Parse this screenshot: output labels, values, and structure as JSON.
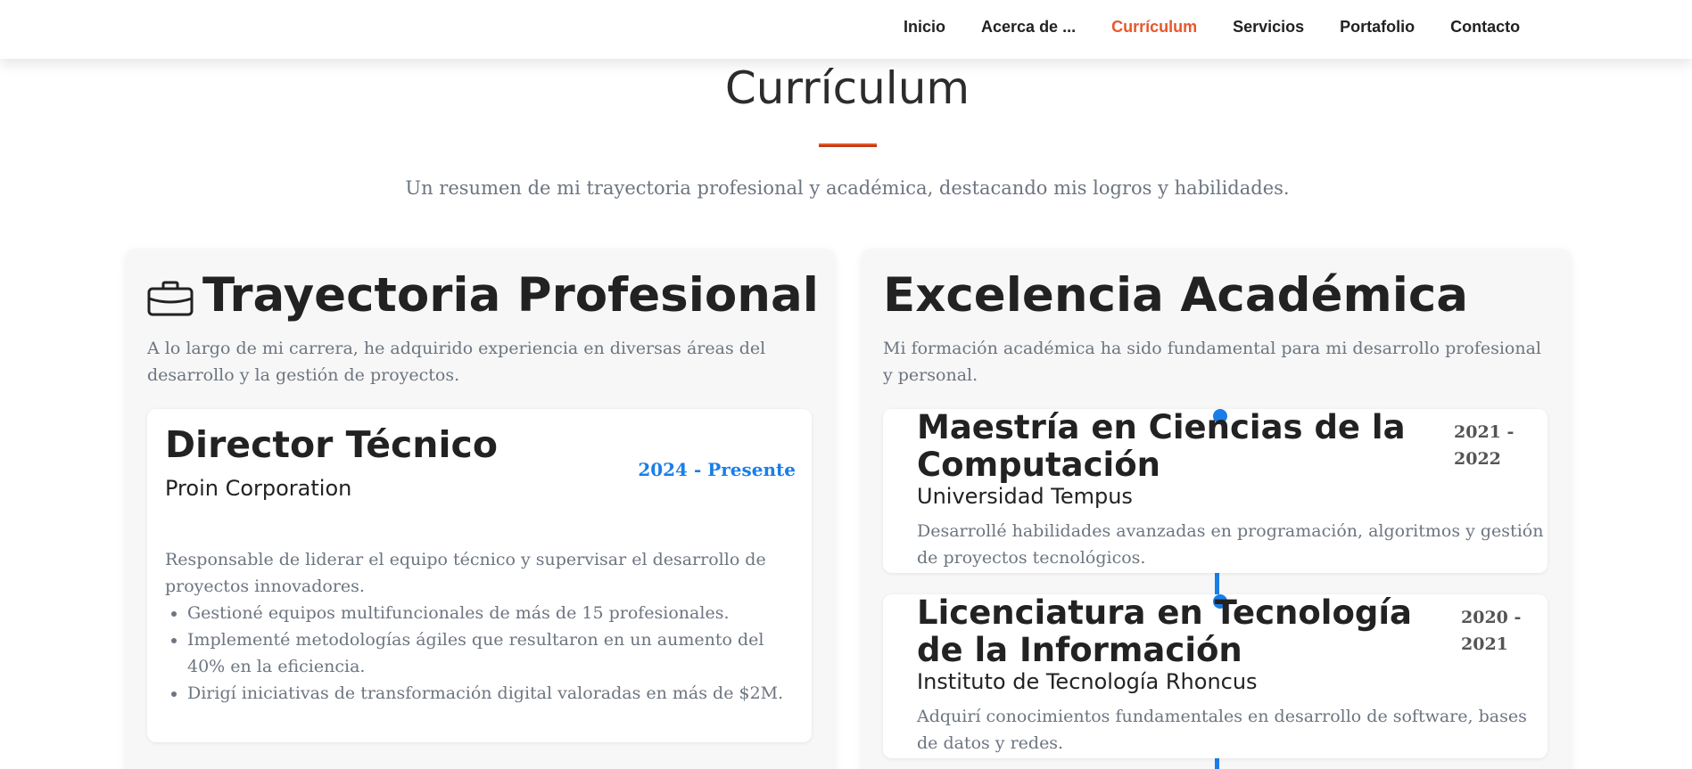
{
  "nav": {
    "items": [
      "Inicio",
      "Acerca de ...",
      "Currículum",
      "Servicios",
      "Portafolio",
      "Contacto"
    ],
    "active_index": 2
  },
  "section": {
    "title": "Currículum",
    "subtitle": "Un resumen de mi trayectoria profesional y académica, destacando mis logros y habilidades."
  },
  "professional": {
    "icon": "briefcase-icon",
    "title": "Trayectoria Profesional",
    "description": "A lo largo de mi carrera, he adquirido experiencia en diversas áreas del desarrollo y la gestión de proyectos.",
    "job": {
      "title": "Director Técnico",
      "company": "Proin Corporation",
      "dates": "2024 - Presente",
      "description": "Responsable de liderar el equipo técnico y supervisar el desarrollo de proyectos innovadores.",
      "achievements": [
        "Gestioné equipos multifuncionales de más de 15 profesionales.",
        "Implementé metodologías ágiles que resultaron en un aumento del 40% en la eficiencia.",
        "Dirigí iniciativas de transformación digital valoradas en más de $2M."
      ]
    }
  },
  "academic": {
    "title": "Excelencia Académica",
    "description": "Mi formación académica ha sido fundamental para mi desarrollo profesional y personal.",
    "entries": [
      {
        "title": "Maestría en Ciencias de la Computación",
        "school": "Universidad Tempus",
        "years": "2021 - 2022",
        "description": "Desarrollé habilidades avanzadas en programación, algoritmos y gestión de proyectos tecnológicos."
      },
      {
        "title": "Licenciatura en Tecnología de la Información",
        "school": "Instituto de Tecnología Rhoncus",
        "years": "2020 - 2021",
        "description": "Adquirí conocimientos fundamentales en desarrollo de software, bases de datos y redes."
      }
    ]
  },
  "colors": {
    "accent": "#e8562a",
    "timeline": "#1a7ee8",
    "muted_text": "#6c7580"
  }
}
